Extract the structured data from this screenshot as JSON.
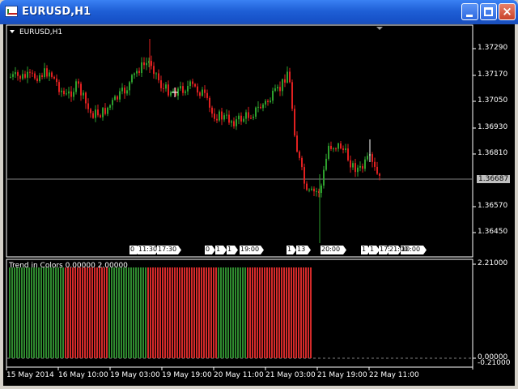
{
  "window": {
    "title": "EURUSD,H1",
    "icon": "chart-window-icon"
  },
  "chart": {
    "symbol_label": "EURUSD,H1",
    "price_labels": [
      "1.37290",
      "1.37170",
      "1.37050",
      "1.36930",
      "1.36810",
      "1.36570",
      "1.36450"
    ],
    "current_price": "1.36687",
    "session_labels": [
      "0",
      "11:30",
      "17:30",
      "0",
      "1",
      "1",
      "19:00",
      "1",
      "13",
      "20:00",
      "1",
      "1",
      "17:",
      "21:00",
      "10:00"
    ],
    "indicator_title": "Trend in Colors 0.00000 2.00000",
    "indicator_scale": [
      "2.21000",
      "0.00000",
      "-0.21000"
    ],
    "time_labels": [
      "15 May 2014",
      "16 May 10:00",
      "19 May 03:00",
      "19 May 19:00",
      "20 May 11:00",
      "21 May 03:00",
      "21 May 19:00",
      "22 May 11:00"
    ]
  },
  "chart_data": {
    "type": "bar",
    "title": "Trend in Colors 0.00000 2.00000",
    "series": [
      {
        "values": [
          2,
          0,
          2,
          0,
          2,
          0
        ]
      }
    ],
    "categories": [
      "15 May 2014",
      "16 May 10:00",
      "19 May 03:00",
      "19 May 19:00",
      "21 May 03:00",
      "21 May 19:00"
    ],
    "ylim": [
      -0.21,
      2.21
    ],
    "colors": {
      "up": "#2f8a2f",
      "down": "#d42a2a"
    },
    "segments": [
      {
        "color": "green",
        "bars": 11
      },
      {
        "color": "red",
        "bars": 9
      },
      {
        "color": "green",
        "bars": 8
      },
      {
        "color": "red",
        "bars": 14
      },
      {
        "color": "green",
        "bars": 6
      },
      {
        "color": "red",
        "bars": 13
      }
    ]
  },
  "colors": {
    "bull": "#2ea02e",
    "bear": "#e02020",
    "grid": "#808080",
    "background": "#000000"
  }
}
